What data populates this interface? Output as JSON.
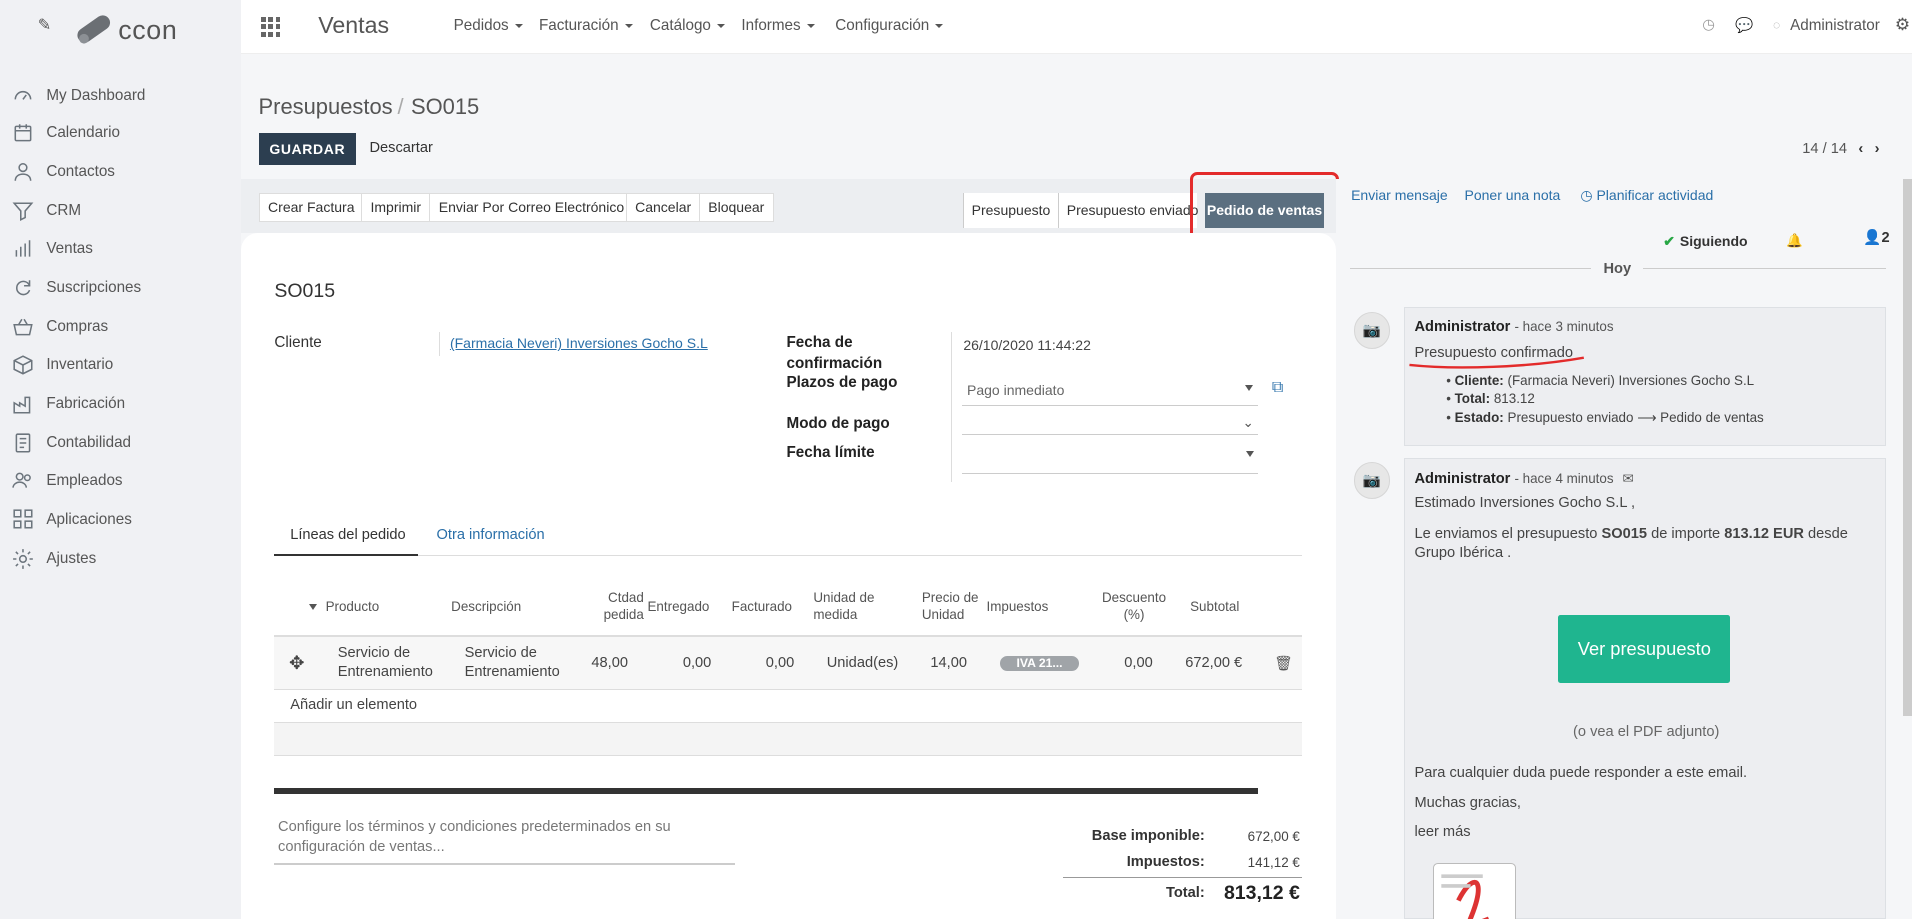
{
  "app": {
    "logo": "ccon",
    "title": "Ventas",
    "admin": "Administrator"
  },
  "sidebar": {
    "items": [
      {
        "label": "My Dashboard",
        "icon": "dashboard-icon"
      },
      {
        "label": "Calendario",
        "icon": "calendar-icon"
      },
      {
        "label": "Contactos",
        "icon": "user-icon"
      },
      {
        "label": "CRM",
        "icon": "filter-icon"
      },
      {
        "label": "Ventas",
        "icon": "bar-chart-icon"
      },
      {
        "label": "Suscripciones",
        "icon": "refresh-icon"
      },
      {
        "label": "Compras",
        "icon": "basket-icon"
      },
      {
        "label": "Inventario",
        "icon": "box-icon"
      },
      {
        "label": "Fabricación",
        "icon": "factory-icon"
      },
      {
        "label": "Contabilidad",
        "icon": "ledger-icon"
      },
      {
        "label": "Empleados",
        "icon": "users-icon"
      },
      {
        "label": "Aplicaciones",
        "icon": "apps-grid-icon"
      },
      {
        "label": "Ajustes",
        "icon": "gear-icon"
      }
    ]
  },
  "menu": [
    "Pedidos",
    "Facturación",
    "Catálogo",
    "Informes",
    "Configuración"
  ],
  "breadcrumb": {
    "parent": "Presupuestos",
    "current": "SO015"
  },
  "control": {
    "save": "GUARDAR",
    "discard": "Descartar",
    "pager": "14 / 14"
  },
  "actions": [
    "Crear Factura",
    "Imprimir",
    "Enviar Por Correo Electrónico",
    "Cancelar",
    "Bloquear"
  ],
  "stages": {
    "draft": "Presupuesto",
    "sent": "Presupuesto enviado",
    "active": "Pedido de ventas"
  },
  "form": {
    "name": "SO015",
    "cliente_label": "Cliente",
    "cliente_value": "(Farmacia Neveri) Inversiones Gocho S.L",
    "fecha_conf_label_1": "Fecha de",
    "fecha_conf_label_2": "confirmación",
    "fecha_conf_value": "26/10/2020 11:44:22",
    "plazos_label": "Plazos de pago",
    "plazos_value": "Pago inmediato",
    "modo_label": "Modo de pago",
    "modo_value": "",
    "limite_label": "Fecha límite",
    "limite_value": ""
  },
  "tabs": [
    "Líneas del pedido",
    "Otra información"
  ],
  "table": {
    "headers": {
      "producto": "Producto",
      "descripcion": "Descripción",
      "ctdad_1": "Ctdad",
      "ctdad_2": "pedida",
      "entregado": "Entregado",
      "facturado": "Facturado",
      "unidad_1": "Unidad de",
      "unidad_2": "medida",
      "precio_1": "Precio de",
      "precio_2": "Unidad",
      "impuestos": "Impuestos",
      "descuento_1": "Descuento",
      "descuento_2": "(%)",
      "subtotal": "Subtotal"
    },
    "row": {
      "producto_1": "Servicio de",
      "producto_2": "Entrenamiento",
      "descripcion_1": "Servicio de",
      "descripcion_2": "Entrenamiento",
      "ctdad": "48,00",
      "entregado": "0,00",
      "facturado": "0,00",
      "unidad": "Unidad(es)",
      "precio": "14,00",
      "impuestos": "IVA 21...",
      "descuento": "0,00",
      "subtotal": "672,00 €"
    },
    "add": "Añadir un elemento"
  },
  "terms_placeholder": "Configure los términos y condiciones predeterminados en su configuración de ventas...",
  "totals": {
    "base_label": "Base imponible:",
    "base_value": "672,00 €",
    "tax_label": "Impuestos:",
    "tax_value": "141,12 €",
    "total_label": "Total:",
    "total_value": "813,12 €"
  },
  "chatter": {
    "send": "Enviar mensaje",
    "note": "Poner una nota",
    "activity": "Planificar actividad",
    "following": "Siguiendo",
    "followers": "2",
    "today": "Hoy",
    "msg1": {
      "author": "Administrator",
      "time": "- hace 3 minutos",
      "body": "Presupuesto confirmado",
      "b1_label": "Cliente:",
      "b1_value": "(Farmacia Neveri) Inversiones Gocho S.L",
      "b2_label": "Total:",
      "b2_value": "813.12",
      "b3_label": "Estado:",
      "b3_value": "Presupuesto enviado ⟶ Pedido de ventas"
    },
    "msg2": {
      "author": "Administrator",
      "time": "- hace 4 minutos",
      "greet": "Estimado Inversiones Gocho S.L ,",
      "p1a": "Le enviamos el presupuesto ",
      "p1b": "SO015",
      "p1c": " de importe ",
      "p1d": "813.12 EUR",
      "p1e": " desde",
      "p1f": "Grupo Ibérica .",
      "cta": "Ver presupuesto",
      "pdf": "(o vea el PDF adjunto)",
      "doubt": "Para cualquier duda puede responder a este email.",
      "thanks": "Muchas gracias,",
      "more": "leer más"
    }
  },
  "colors": {
    "primary": "#2c3e50",
    "accent": "#1fb58f",
    "stage_active": "#5b6f80",
    "annotation": "#e32b2b",
    "link": "#2a6fa8"
  }
}
